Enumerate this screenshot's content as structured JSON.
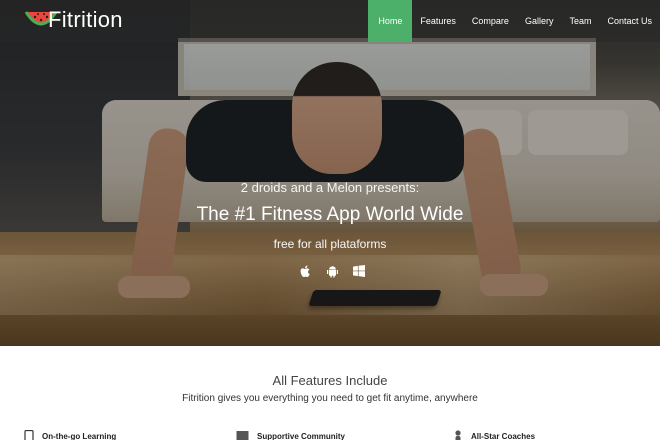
{
  "brand": {
    "name": "Fitrition",
    "logo_icon": "watermelon-logo-icon"
  },
  "nav": {
    "items": [
      {
        "label": "Home",
        "active": true
      },
      {
        "label": "Features",
        "active": false
      },
      {
        "label": "Compare",
        "active": false
      },
      {
        "label": "Gallery",
        "active": false
      },
      {
        "label": "Team",
        "active": false
      },
      {
        "label": "Contact Us",
        "active": false
      }
    ],
    "active_color": "#4caf6a"
  },
  "hero": {
    "presents": "2 droids and a Melon presents:",
    "title": "The #1 Fitness App World Wide",
    "subtitle": "free for all plataforms",
    "platform_icons": [
      "apple-icon",
      "android-icon",
      "windows-icon"
    ]
  },
  "features": {
    "title": "All Features Include",
    "subtitle": "Fitrition gives you everything you need to get fit anytime, anywhere",
    "items": [
      {
        "label": "On-the-go Learning",
        "icon": "phone-icon"
      },
      {
        "label": "Supportive Community",
        "icon": "community-icon"
      },
      {
        "label": "All-Star Coaches",
        "icon": "coach-icon"
      }
    ]
  }
}
